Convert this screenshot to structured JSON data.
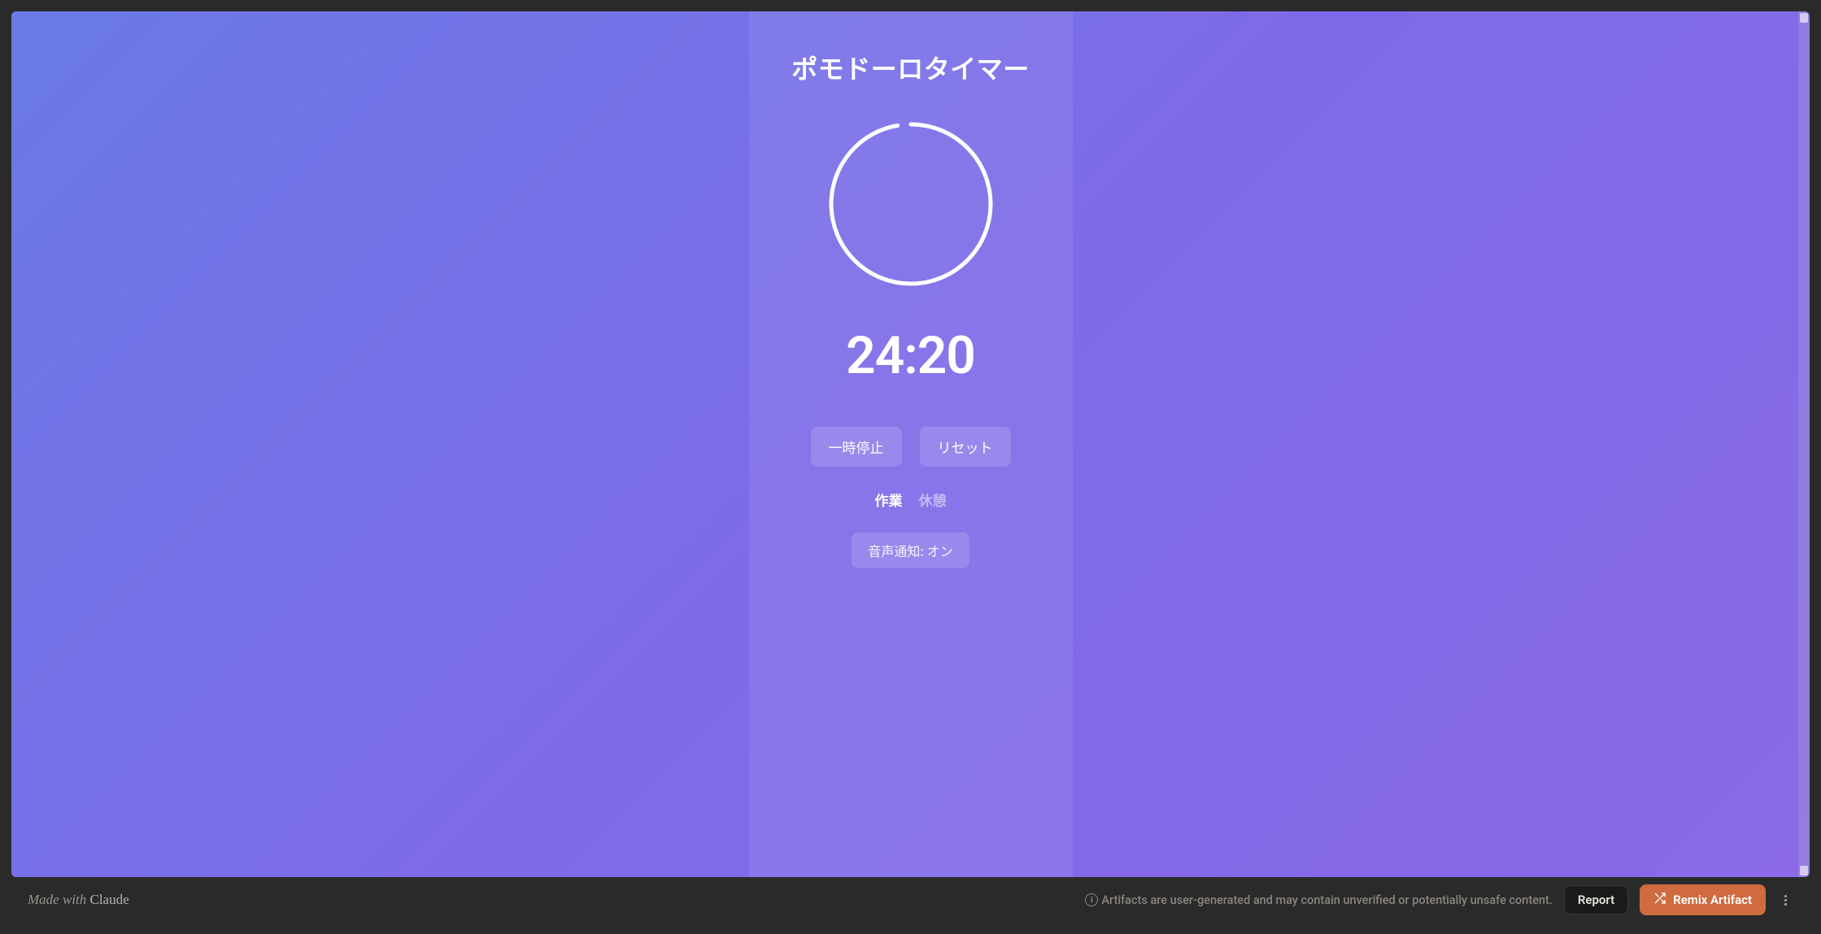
{
  "timer": {
    "title": "ポモドーロタイマー",
    "time_display": "24:20",
    "progress_fraction": 0.973,
    "pause_label": "一時停止",
    "reset_label": "リセット",
    "mode_work": "作業",
    "mode_break": "休憩",
    "active_mode": "work",
    "sound_label": "音声通知: オン"
  },
  "footer": {
    "made_with_prefix": "Made with ",
    "made_with_brand": "Claude",
    "warning": "Artifacts are user-generated and may contain unverified or potentially unsafe content.",
    "report_label": "Report",
    "remix_label": "Remix Artifact"
  },
  "colors": {
    "gradient_start": "#6b7ae8",
    "gradient_end": "#8a6ae8",
    "accent": "#cf6b3f"
  }
}
